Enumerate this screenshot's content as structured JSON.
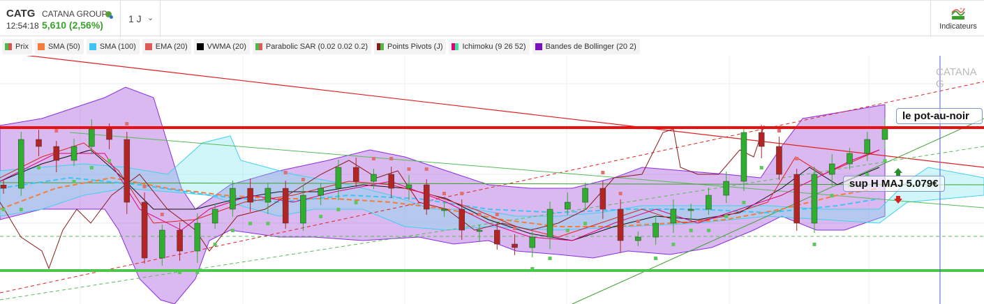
{
  "header": {
    "symbol": "CATG",
    "company": "CATANA GROUP",
    "time": "12:54:18",
    "price": "5,610 (2,56%)",
    "period": "1 J",
    "indicators_label": "Indicateurs"
  },
  "legend": [
    {
      "label": "Prix",
      "color": "#4cbb4c",
      "color2": "#d9534f"
    },
    {
      "label": "SMA (50)",
      "color": "#f57c3a"
    },
    {
      "label": "SMA (100)",
      "color": "#3fc3f5"
    },
    {
      "label": "EMA (20)",
      "color": "#e05a5a"
    },
    {
      "label": "VWMA (20)",
      "color": "#000000"
    },
    {
      "label": "Parabolic SAR (0.02 0.02 0.2)",
      "color": "#4cbb4c",
      "color2": "#e05a5a"
    },
    {
      "label": "Points Pivots (J)",
      "color": "#8b1a1a",
      "color2": "#4cbb4c"
    },
    {
      "label": "Ichimoku (9 26 52)",
      "color": "#e0007a",
      "color2": "#3fe0a0"
    },
    {
      "label": "Bandes de Bollinger (20 2)",
      "color": "#7b0fbf"
    }
  ],
  "watermark": "CATANA G",
  "annotations": {
    "resistance": "le pot-au-noir",
    "support": "sup H MAJ 5.079€"
  },
  "chart_data": {
    "type": "candlestick",
    "closes": [
      5.053,
      5.501,
      5.437,
      5.309,
      5.437,
      5.597,
      5.501,
      4.925,
      4.413,
      4.669,
      4.477,
      4.733,
      4.861,
      5.053,
      4.925,
      5.053,
      4.733,
      4.989,
      5.053,
      5.245,
      5.117,
      5.181,
      5.053,
      5.085,
      4.861,
      4.861,
      4.669,
      4.669,
      4.541,
      4.509,
      4.605,
      4.861,
      4.925,
      5.053,
      4.861,
      4.573,
      4.605,
      4.733,
      4.861,
      4.861,
      4.989,
      5.117,
      5.565,
      5.437,
      5.181,
      4.733,
      5.181,
      5.277,
      5.373,
      5.501,
      5.61
    ],
    "resistance_level": 5.61,
    "support_level": 5.079,
    "lower_support": 4.31,
    "last_price": 5.61,
    "up_color": "#2fae2f",
    "down_color": "#b32525"
  }
}
